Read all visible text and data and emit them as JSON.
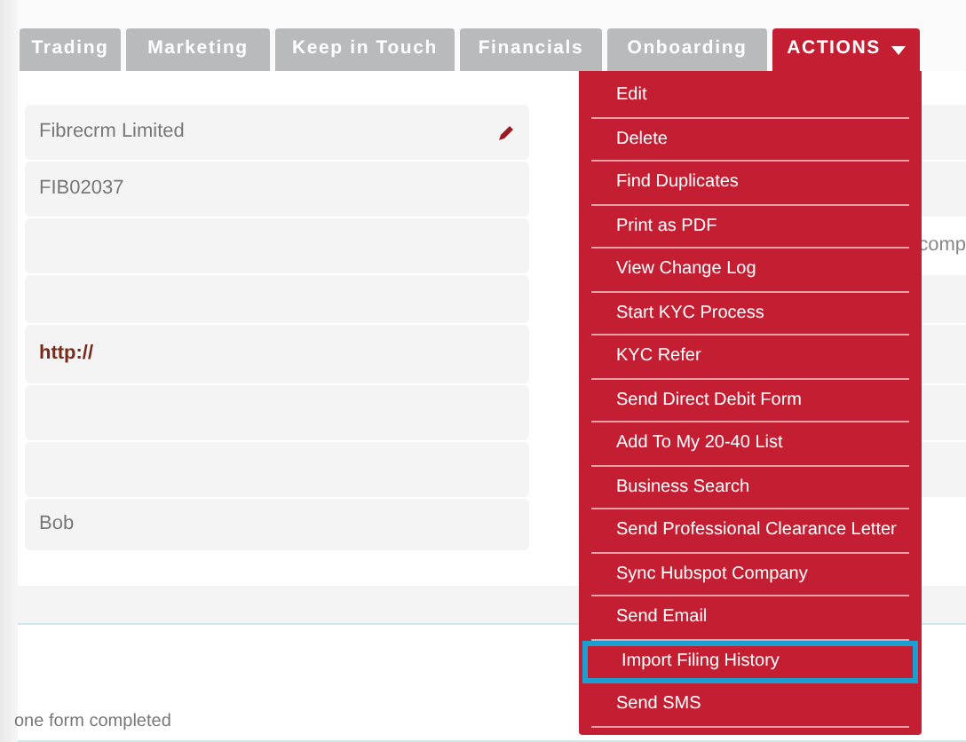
{
  "tabs": [
    {
      "label": "Trading",
      "selected": false
    },
    {
      "label": "Marketing",
      "selected": false
    },
    {
      "label": "Keep in Touch",
      "selected": false
    },
    {
      "label": "Financials",
      "selected": false
    },
    {
      "label": "Onboarding",
      "selected": false
    },
    {
      "label": "ACTIONS",
      "selected": true
    }
  ],
  "fields": [
    {
      "value": "Fibrecrm Limited",
      "kind": "editable"
    },
    {
      "value": "FIB02037",
      "kind": "plain"
    },
    {
      "kind": "plain"
    },
    {
      "kind": "plain"
    },
    {
      "value": "http://",
      "kind": "link"
    },
    {
      "kind": "plain"
    },
    {
      "kind": "plain"
    },
    {
      "value": "Bob",
      "kind": "plain"
    }
  ],
  "right_text": "comp",
  "actions_menu": [
    {
      "label": "Edit",
      "highlighted": false
    },
    {
      "label": "Delete",
      "highlighted": false
    },
    {
      "label": "Find Duplicates",
      "highlighted": false
    },
    {
      "label": "Print as PDF",
      "highlighted": false
    },
    {
      "label": "View Change Log",
      "highlighted": false
    },
    {
      "label": "Start KYC Process",
      "highlighted": false
    },
    {
      "label": "KYC Refer",
      "highlighted": false
    },
    {
      "label": "Send Direct Debit Form",
      "highlighted": false
    },
    {
      "label": "Add To My 20-40 List",
      "highlighted": false
    },
    {
      "label": "Business Search",
      "highlighted": false
    },
    {
      "label": "Send Professional Clearance Letter",
      "highlighted": false
    },
    {
      "label": "Sync Hubspot Company",
      "highlighted": false
    },
    {
      "label": "Send Email",
      "highlighted": false
    },
    {
      "label": "Import Filing History",
      "highlighted": true
    },
    {
      "label": "Send SMS",
      "highlighted": false
    }
  ],
  "footer_text": "one form completed"
}
